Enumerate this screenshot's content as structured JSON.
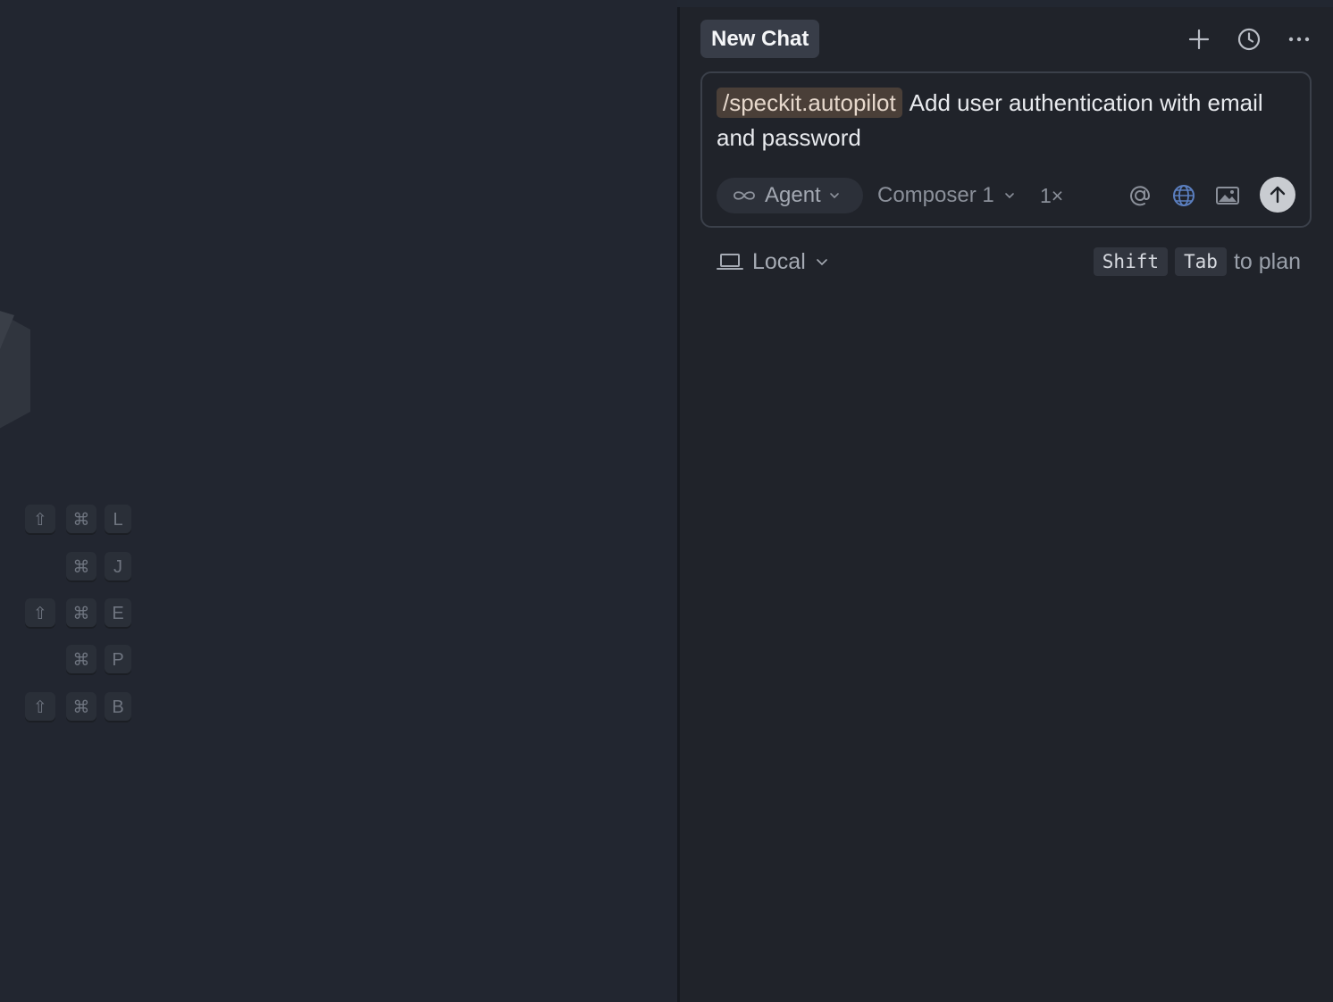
{
  "editor": {
    "logo_icon": "cursor-logo-icon",
    "shortcuts": [
      {
        "modifiers": [
          "shift-icon",
          "command-icon"
        ],
        "key": "L"
      },
      {
        "modifiers": [
          "command-icon"
        ],
        "key": "J"
      },
      {
        "modifiers": [
          "shift-icon",
          "command-icon"
        ],
        "key": "E"
      },
      {
        "modifiers": [
          "command-icon"
        ],
        "key": "P"
      },
      {
        "modifiers": [
          "shift-icon",
          "command-icon"
        ],
        "key": "B"
      }
    ]
  },
  "chat": {
    "tab_title": "New Chat",
    "header_actions": [
      "plus-icon",
      "history-clock-icon",
      "more-ellipsis-icon"
    ],
    "composer": {
      "slash_command": "/speckit.autopilot",
      "prompt": "Add user authentication with email and password",
      "mode_label": "Agent",
      "mode_icon": "infinity-icon",
      "model_label": "Composer 1",
      "speed_label": "1×",
      "tools": [
        "at-mention-icon",
        "globe-icon",
        "image-icon"
      ],
      "send_icon": "arrow-up-icon"
    },
    "footer": {
      "environment_label": "Local",
      "environment_icon": "laptop-icon",
      "hint_keys": [
        "Shift",
        "Tab"
      ],
      "hint_text": "to plan"
    }
  },
  "colors": {
    "editor_bg": "#222630",
    "chat_bg": "#20232a",
    "tab_bg": "#383d48",
    "slash_chip_bg": "#4a3f38",
    "globe_accent": "#5b7fc0",
    "send_bg": "#c9ccd1"
  }
}
